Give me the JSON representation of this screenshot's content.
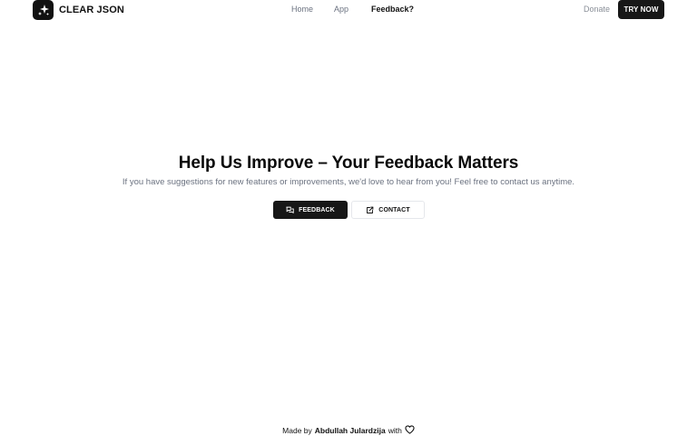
{
  "brand": {
    "name": "CLEAR JSON",
    "icon": "sparkles-icon"
  },
  "nav": {
    "home": "Home",
    "app": "App",
    "feedback": "Feedback?"
  },
  "header_actions": {
    "donate": "Donate",
    "try_now": "TRY NOW"
  },
  "hero": {
    "title": "Help Us Improve – Your Feedback Matters",
    "subtitle": "If you have suggestions for new features or improvements, we'd love to hear from you! Feel free to contact us anytime.",
    "feedback_button": "FEEDBACK",
    "feedback_icon": "message-squares-icon",
    "contact_button": "CONTACT",
    "contact_icon": "external-link-icon"
  },
  "footer": {
    "prefix": "Made by",
    "author": "Abdullah Julardzija",
    "suffix": "with",
    "icon": "heart-icon"
  },
  "colors": {
    "primary": "#171717",
    "muted_text": "#6b7280",
    "background": "#ffffff"
  }
}
